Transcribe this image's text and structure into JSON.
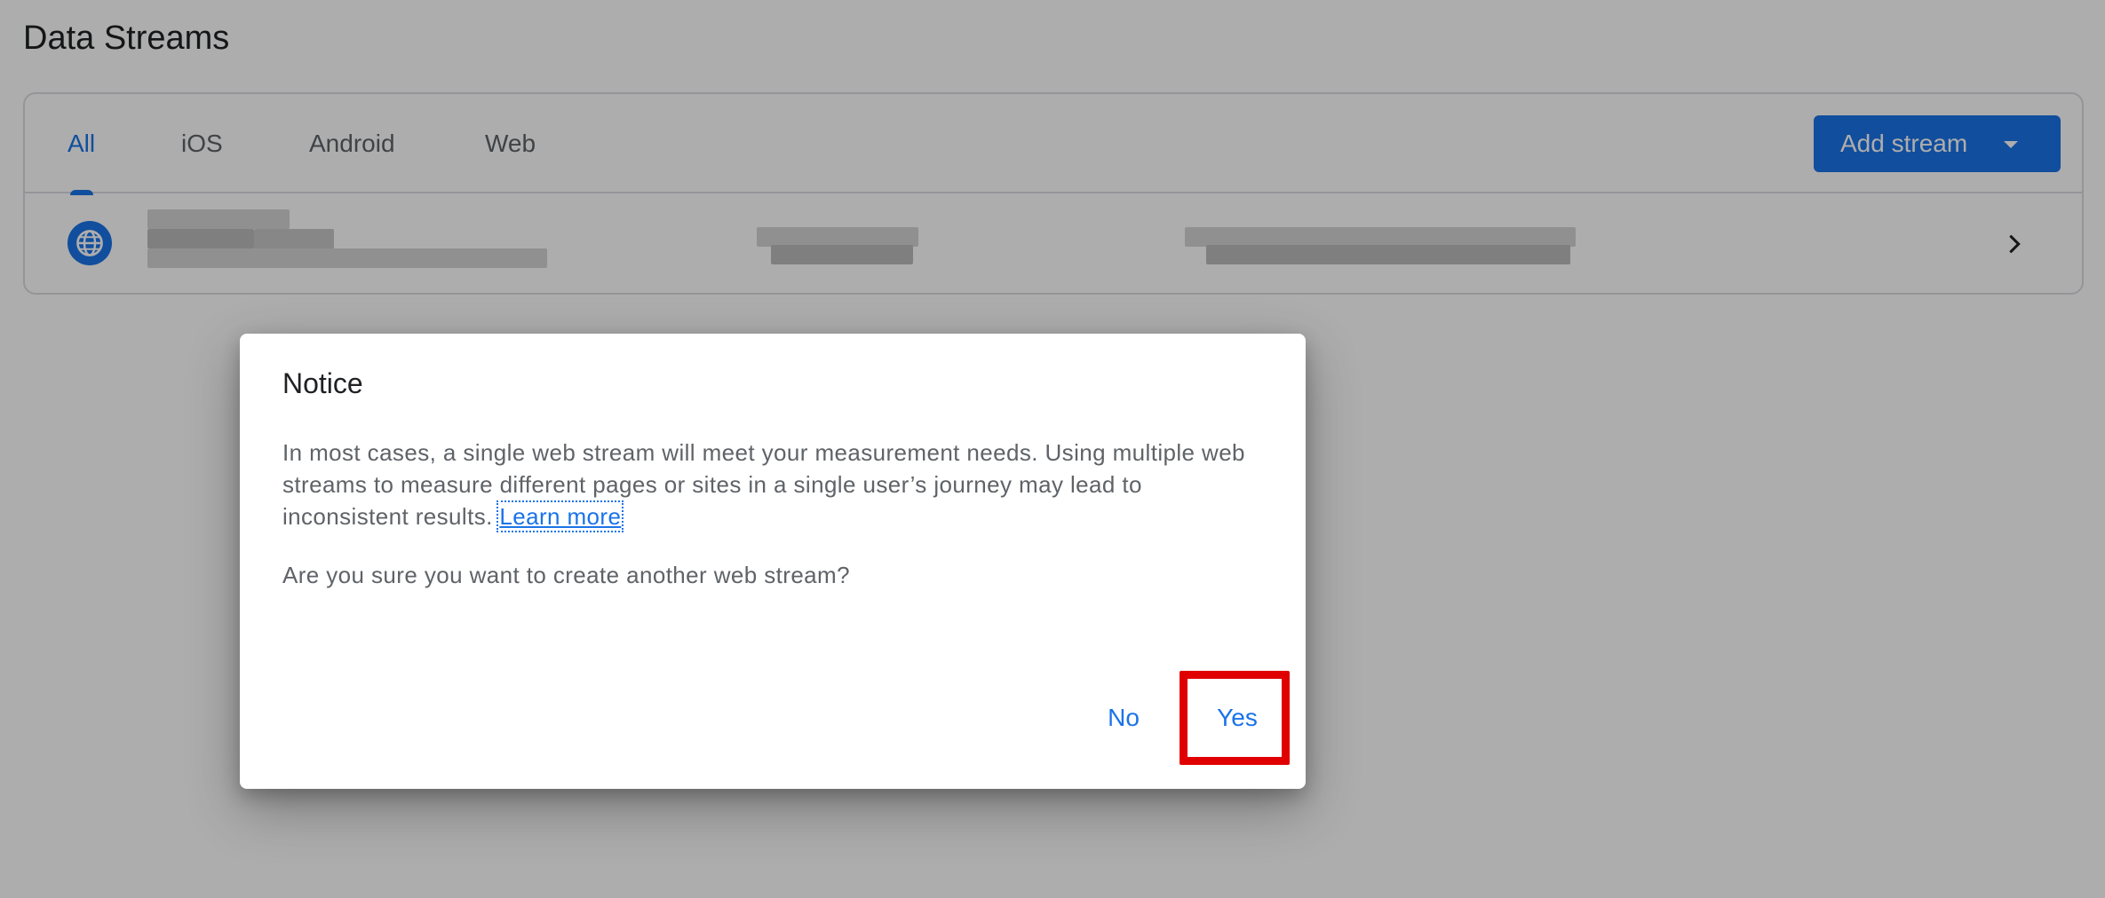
{
  "page": {
    "title": "Data Streams"
  },
  "tabs": [
    {
      "label": "All",
      "active": true
    },
    {
      "label": "iOS",
      "active": false
    },
    {
      "label": "Android",
      "active": false
    },
    {
      "label": "Web",
      "active": false
    }
  ],
  "toolbar": {
    "add_stream_label": "Add stream"
  },
  "stream_row": {
    "icon": "globe-icon",
    "name": "",
    "stream_id": "",
    "url": "",
    "redacted": true
  },
  "dialog": {
    "title": "Notice",
    "body": "In most cases, a single web stream will meet your measurement needs. Using multiple web streams to measure different pages or sites in a single user’s journey may lead to inconsistent results. ",
    "learn_more": "Learn more",
    "question": "Are you sure you want to create another web stream?",
    "no_label": "No",
    "yes_label": "Yes"
  },
  "colors": {
    "accent": "#1a73e8",
    "highlight": "#e00000",
    "scrim": "rgba(0,0,0,0.32)"
  }
}
